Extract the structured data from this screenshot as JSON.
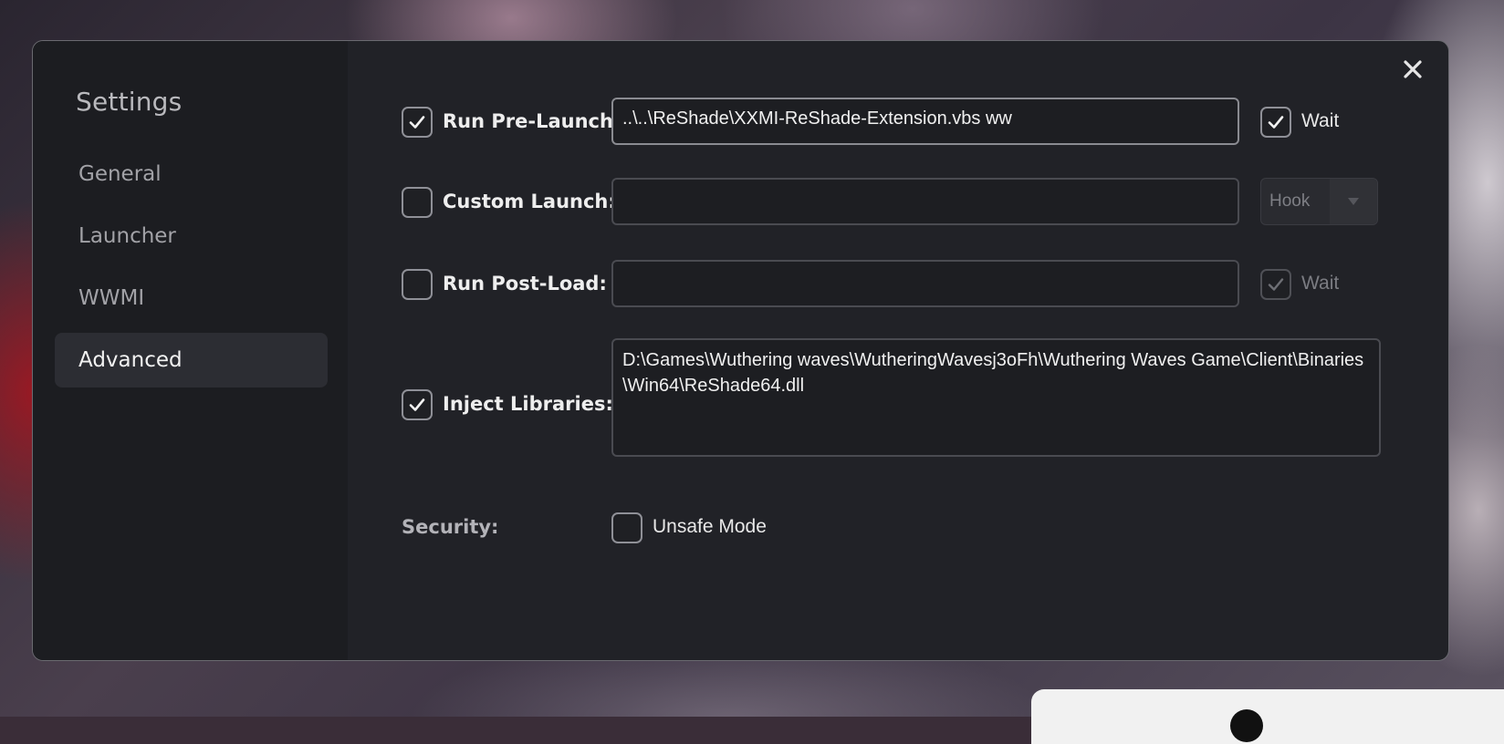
{
  "sidebar": {
    "title": "Settings",
    "items": [
      {
        "label": "General"
      },
      {
        "label": "Launcher"
      },
      {
        "label": "WWMI"
      },
      {
        "label": "Advanced"
      }
    ],
    "active": "Advanced"
  },
  "close_icon": "close-icon",
  "rows": {
    "run_pre_launch": {
      "label": "Run Pre-Launch:",
      "checked": true,
      "value": "..\\..\\ReShade\\XXMI-ReShade-Extension.vbs ww",
      "wait_label": "Wait",
      "wait_checked": true
    },
    "custom_launch": {
      "label": "Custom Launch:",
      "checked": false,
      "value": "",
      "mode_select": "Hook"
    },
    "run_post_load": {
      "label": "Run Post-Load:",
      "checked": false,
      "value": "",
      "wait_label": "Wait",
      "wait_checked": true,
      "wait_disabled": true
    },
    "inject_libraries": {
      "label": "Inject Libraries:",
      "checked": true,
      "value": "D:\\Games\\Wuthering waves\\WutheringWavesj3oFh\\Wuthering Waves Game\\Client\\Binaries\\Win64\\ReShade64.dll"
    },
    "security": {
      "label": "Security:",
      "unsafe_mode_label": "Unsafe Mode",
      "unsafe_mode_checked": false
    }
  },
  "colors": {
    "dialog_bg": "#212227",
    "sidebar_bg": "#1c1d21",
    "active_nav_bg": "#2c2d33",
    "text_primary": "#eeeeee",
    "text_muted": "#a2a2a7"
  }
}
